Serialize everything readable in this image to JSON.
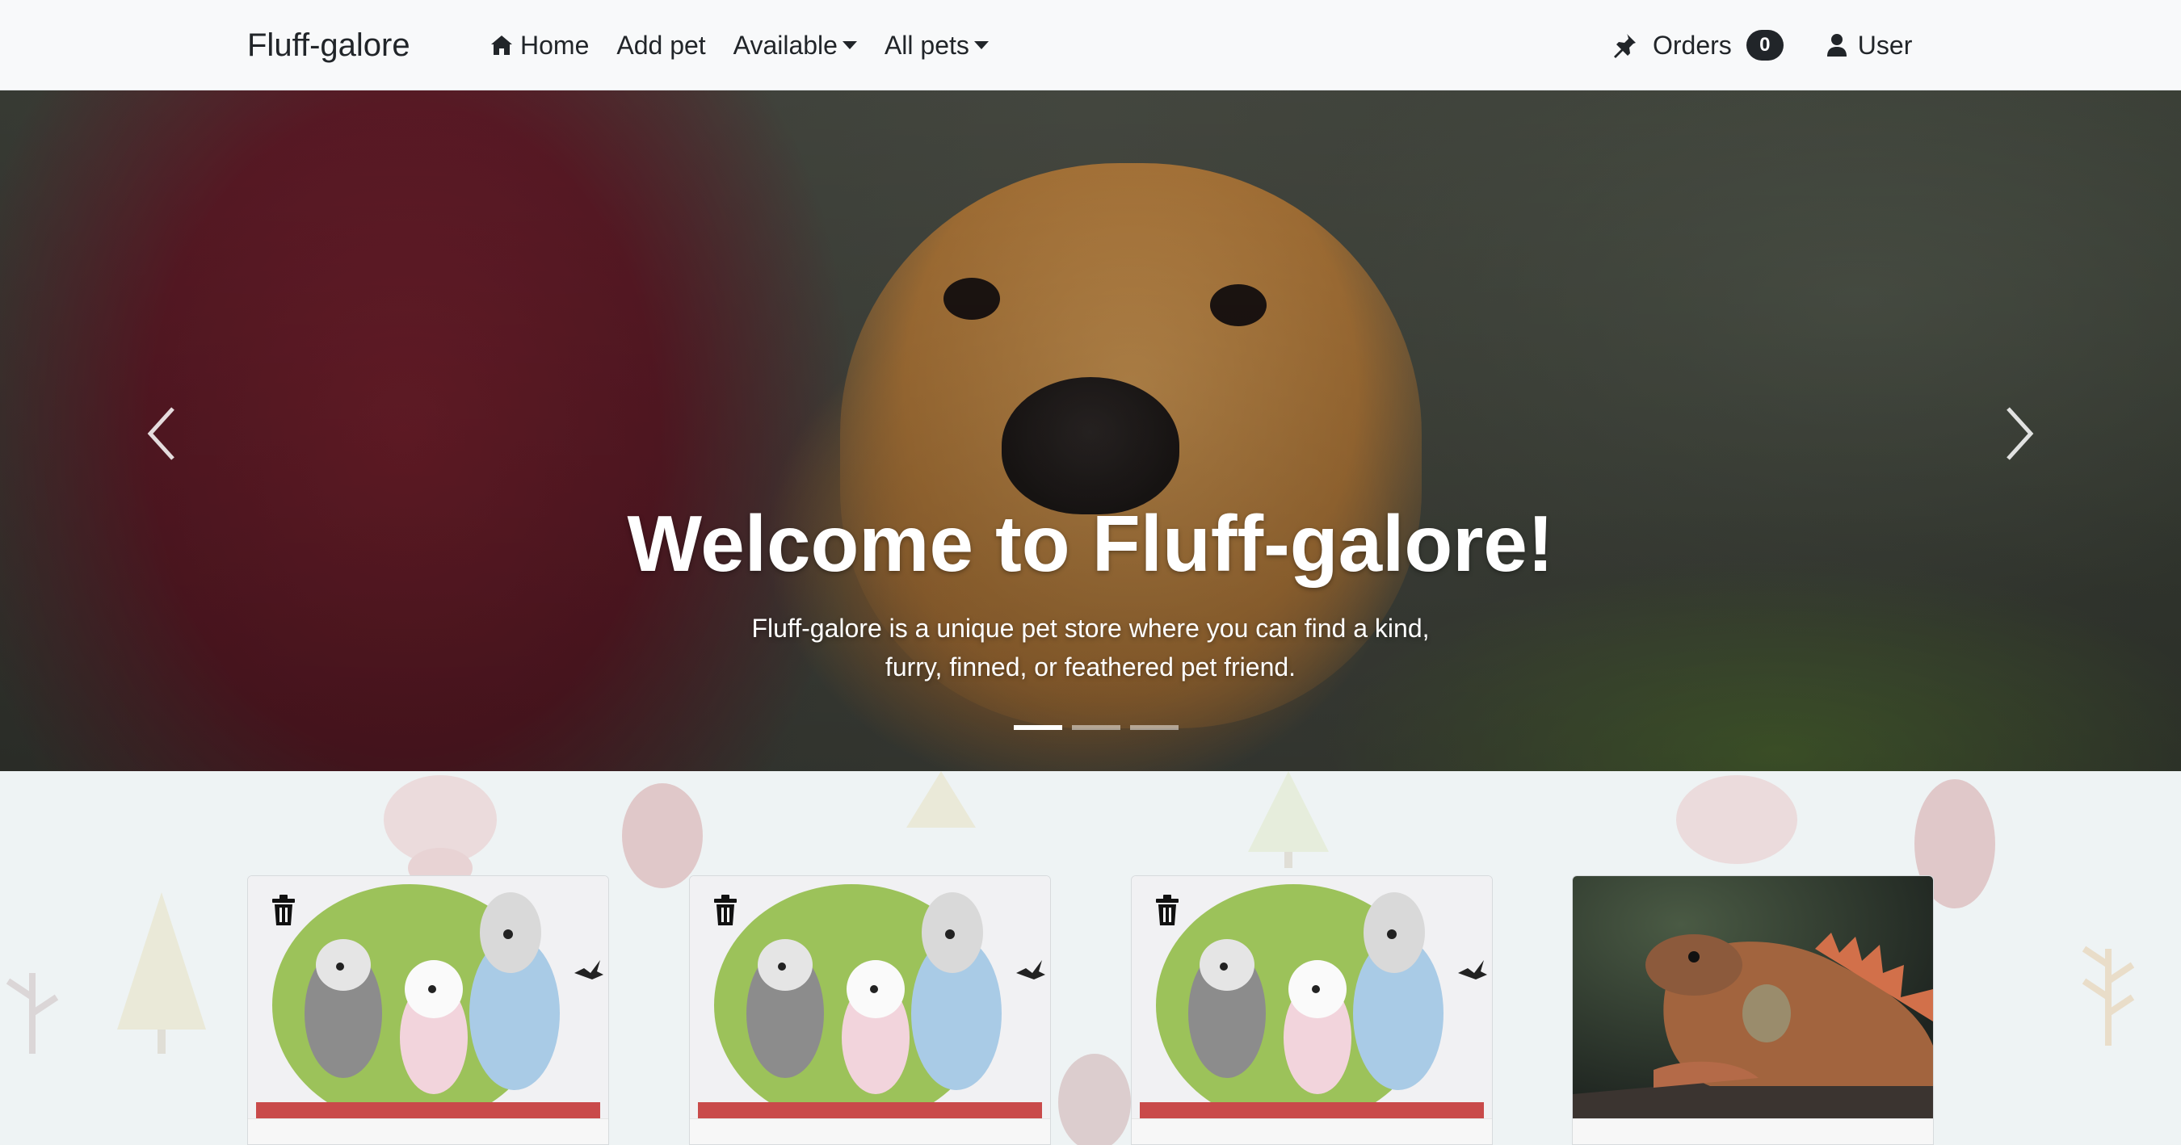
{
  "navbar": {
    "brand": "Fluff-galore",
    "items": [
      {
        "label": "Home",
        "icon": "home-icon"
      },
      {
        "label": "Add pet"
      },
      {
        "label": "Available",
        "dropdown": true
      },
      {
        "label": "All pets",
        "dropdown": true
      }
    ],
    "orders": {
      "label": "Orders",
      "icon": "pin-icon",
      "count": "0"
    },
    "user": {
      "label": "User",
      "icon": "user-icon"
    }
  },
  "hero": {
    "title": "Welcome to Fluff-galore!",
    "text": "Fluff-galore is a unique pet store where you can find a kind, furry, finned, or feathered pet friend.",
    "slides": 3,
    "active_slide": 1
  },
  "cards": [
    {
      "image": "dogs-photo"
    },
    {
      "image": "dogs-photo"
    },
    {
      "image": "dogs-photo"
    },
    {
      "image": "iguana-photo"
    }
  ],
  "colors": {
    "navbar_bg": "#f8f9fa",
    "badge_bg": "#212529",
    "page_bg": "#eef3f4"
  }
}
